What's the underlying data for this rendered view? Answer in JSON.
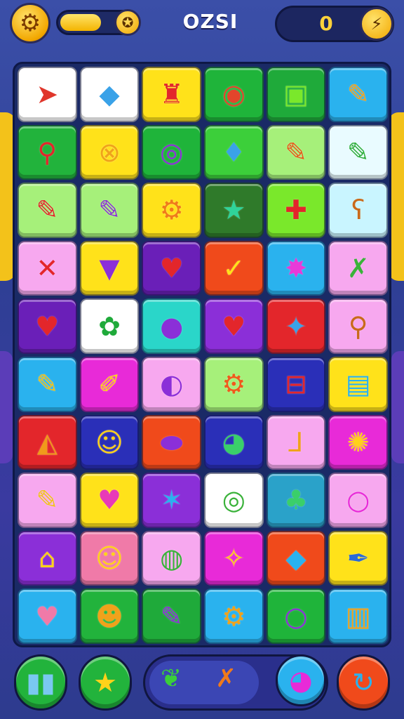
{
  "header": {
    "title": "OZSI",
    "score": "0",
    "energy_level": 0.62,
    "settings_icon": "gear-icon",
    "energy_icon": "star-icon",
    "score_icon": "bolt-icon"
  },
  "board": {
    "rows": 10,
    "cols": 6,
    "tiles": [
      {
        "color": "#ffffff",
        "icon": "paper-plane",
        "glyph": "➤",
        "fg": "#e0362b"
      },
      {
        "color": "#ffffff",
        "icon": "gem",
        "glyph": "◆",
        "fg": "#3aa2e8"
      },
      {
        "color": "#ffe21a",
        "icon": "gift-bag",
        "glyph": "♜",
        "fg": "#e3262b"
      },
      {
        "color": "#1fb43a",
        "icon": "shell",
        "glyph": "◉",
        "fg": "#e3452b"
      },
      {
        "color": "#1faa3a",
        "icon": "card",
        "glyph": "▣",
        "fg": "#7ae82b"
      },
      {
        "color": "#2ab2ee",
        "icon": "pencil",
        "glyph": "✎",
        "fg": "#f5a21b"
      },
      {
        "color": "#22b33c",
        "icon": "map-pin",
        "glyph": "⚲",
        "fg": "#e3262b"
      },
      {
        "color": "#ffe21a",
        "icon": "link",
        "glyph": "⊗",
        "fg": "#f0a21b"
      },
      {
        "color": "#1fb43a",
        "icon": "ring",
        "glyph": "◎",
        "fg": "#8b2fd8"
      },
      {
        "color": "#3ccf3a",
        "icon": "leaf",
        "glyph": "♦",
        "fg": "#3aa2e8"
      },
      {
        "color": "#a6f07a",
        "icon": "pencil",
        "glyph": "✎",
        "fg": "#e85a1b"
      },
      {
        "color": "#e9fbff",
        "icon": "pencil",
        "glyph": "✎",
        "fg": "#2fae3a"
      },
      {
        "color": "#a6f07a",
        "icon": "pencil",
        "glyph": "✎",
        "fg": "#e3262b"
      },
      {
        "color": "#a6f07a",
        "icon": "pencil",
        "glyph": "✎",
        "fg": "#8b2fd8"
      },
      {
        "color": "#ffe21a",
        "icon": "drill",
        "glyph": "⚙",
        "fg": "#f07a1b"
      },
      {
        "color": "#2f7a2a",
        "icon": "star",
        "glyph": "★",
        "fg": "#2fd39a"
      },
      {
        "color": "#7ae82b",
        "icon": "first-aid",
        "glyph": "✚",
        "fg": "#e3262b"
      },
      {
        "color": "#c9f5ff",
        "icon": "bear",
        "glyph": "ʕ",
        "fg": "#c96a1b"
      },
      {
        "color": "#f7a8ef",
        "icon": "cross",
        "glyph": "✕",
        "fg": "#e3262b"
      },
      {
        "color": "#ffe21a",
        "icon": "cup",
        "glyph": "▼",
        "fg": "#8b2fd8"
      },
      {
        "color": "#6a1fb8",
        "icon": "heart",
        "glyph": "♥",
        "fg": "#e3262b"
      },
      {
        "color": "#f04a1b",
        "icon": "origami",
        "glyph": "✓",
        "fg": "#ffe21a"
      },
      {
        "color": "#2ab2ee",
        "icon": "splash",
        "glyph": "✸",
        "fg": "#e83ad8"
      },
      {
        "color": "#f7a8ef",
        "icon": "crossed-tools",
        "glyph": "✗",
        "fg": "#3ab23a"
      },
      {
        "color": "#6a1fb8",
        "icon": "heart",
        "glyph": "♥",
        "fg": "#e3262b"
      },
      {
        "color": "#ffffff",
        "icon": "leaf-coin",
        "glyph": "✿",
        "fg": "#1faa3a"
      },
      {
        "color": "#2ad6c9",
        "icon": "bubble",
        "glyph": "●",
        "fg": "#8b2fd8"
      },
      {
        "color": "#8b2fd8",
        "icon": "heart",
        "glyph": "♥",
        "fg": "#e3262b"
      },
      {
        "color": "#e3262b",
        "icon": "candy",
        "glyph": "✦",
        "fg": "#3aa2e8"
      },
      {
        "color": "#f7a8ef",
        "icon": "wand",
        "glyph": "⚲",
        "fg": "#c96a1b"
      },
      {
        "color": "#2ab2ee",
        "icon": "puzzle",
        "glyph": "✎",
        "fg": "#f0c21b"
      },
      {
        "color": "#e82ad8",
        "icon": "bandage",
        "glyph": "✐",
        "fg": "#ffd21a"
      },
      {
        "color": "#f7a8ef",
        "icon": "bubble-letter",
        "glyph": "◐",
        "fg": "#8b2fd8"
      },
      {
        "color": "#a6f07a",
        "icon": "gear",
        "glyph": "⚙",
        "fg": "#f05a1b"
      },
      {
        "color": "#2a2fb8",
        "icon": "toolbox",
        "glyph": "⊟",
        "fg": "#e3262b"
      },
      {
        "color": "#ffe21a",
        "icon": "chart-board",
        "glyph": "▤",
        "fg": "#2ab2ee"
      },
      {
        "color": "#e3262b",
        "icon": "pizza",
        "glyph": "◭",
        "fg": "#f09a1b"
      },
      {
        "color": "#2a2fb8",
        "icon": "smiley",
        "glyph": "☺",
        "fg": "#ffd21a"
      },
      {
        "color": "#f04a1b",
        "icon": "capsule",
        "glyph": "⬬",
        "fg": "#8b2fd8"
      },
      {
        "color": "#2a2fb8",
        "icon": "planet",
        "glyph": "◕",
        "fg": "#3acf6a"
      },
      {
        "color": "#f7a8ef",
        "icon": "boot",
        "glyph": "⅃",
        "fg": "#f0a21b"
      },
      {
        "color": "#e82ad8",
        "icon": "sun-gear",
        "glyph": "✺",
        "fg": "#ffd21a"
      },
      {
        "color": "#f7a8ef",
        "icon": "pencil",
        "glyph": "✎",
        "fg": "#f0c21b"
      },
      {
        "color": "#ffe21a",
        "icon": "heart",
        "glyph": "♥",
        "fg": "#e83ab8"
      },
      {
        "color": "#8b2fd8",
        "icon": "star-bird",
        "glyph": "✶",
        "fg": "#2ab2ee"
      },
      {
        "color": "#ffffff",
        "icon": "spiral",
        "glyph": "◎",
        "fg": "#3ab23a"
      },
      {
        "color": "#2aa2c9",
        "icon": "lamp",
        "glyph": "♣",
        "fg": "#3acf6a"
      },
      {
        "color": "#f7a8ef",
        "icon": "ring",
        "glyph": "○",
        "fg": "#e82ad8"
      },
      {
        "color": "#8b2fd8",
        "icon": "house",
        "glyph": "⌂",
        "fg": "#ffd21a"
      },
      {
        "color": "#f07aa8",
        "icon": "smiley",
        "glyph": "☺",
        "fg": "#ffd21a"
      },
      {
        "color": "#f7a8ef",
        "icon": "ball",
        "glyph": "◍",
        "fg": "#3ab23a"
      },
      {
        "color": "#e82ad8",
        "icon": "bird",
        "glyph": "✧",
        "fg": "#ffd21a"
      },
      {
        "color": "#f04a1b",
        "icon": "gem-bubble",
        "glyph": "◆",
        "fg": "#2ab2ee"
      },
      {
        "color": "#ffe21a",
        "icon": "pen",
        "glyph": "✒",
        "fg": "#2a6ad8"
      },
      {
        "color": "#2ab2ee",
        "icon": "hearts",
        "glyph": "♥",
        "fg": "#f07aa8"
      },
      {
        "color": "#22b33c",
        "icon": "face-block",
        "glyph": "☻",
        "fg": "#f0a21b"
      },
      {
        "color": "#1faa3a",
        "icon": "pencil-square",
        "glyph": "✎",
        "fg": "#8b2fd8"
      },
      {
        "color": "#2ab2ee",
        "icon": "gear",
        "glyph": "⚙",
        "fg": "#f0a21b"
      },
      {
        "color": "#1fb43a",
        "icon": "ring",
        "glyph": "○",
        "fg": "#8b2fd8"
      },
      {
        "color": "#2ab2ee",
        "icon": "box",
        "glyph": "▥",
        "fg": "#f0a21b"
      }
    ]
  },
  "bottom": {
    "left_button": {
      "icon": "crayons-icon",
      "glyph": "▮▮",
      "color": "#22b33c",
      "fg": "#7ac8f0"
    },
    "star_button": {
      "icon": "star-icon",
      "glyph": "★",
      "color": "#22b33c",
      "fg": "#ffd21a"
    },
    "tray_items": [
      {
        "icon": "leaf-icon",
        "glyph": "❦",
        "fg": "#3acf3a"
      },
      {
        "icon": "crossed-tools-icon",
        "glyph": "✗",
        "fg": "#f07a1b"
      }
    ],
    "tray_button": {
      "icon": "bubble-icon",
      "glyph": "◕",
      "color": "#2ab2ee",
      "fg": "#e82ad8"
    },
    "refresh_button": {
      "icon": "refresh-icon",
      "glyph": "↻",
      "color": "#f04a1b",
      "fg": "#2ab2ee"
    }
  }
}
